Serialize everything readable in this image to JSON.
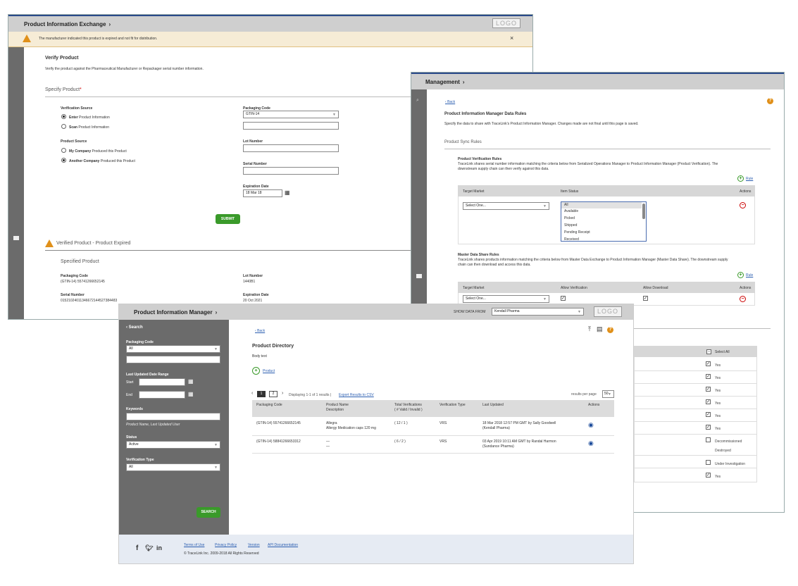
{
  "w1": {
    "title": "Product Information Exchange",
    "logo": "LOGO",
    "alert": "The manufacturer indicated this product is expired and not fit for distribution.",
    "heading": "Verify Product",
    "desc": "Verify the product against the Pharmaceutical Manufacturer or Repackager serial number information.",
    "specify": "Specify Product",
    "req": "*",
    "vsrc_label": "Verification Source",
    "enter_b": "Enter",
    "enter_r": "Product Information",
    "scan_b": "Scan",
    "scan_r": "Product Information",
    "psrc_label": "Product Source",
    "my_b": "My Company",
    "my_r": "Produced this Product",
    "another_b": "Another Company",
    "another_r": "Produced this Product",
    "pkg_label": "Packaging Code",
    "pkg_value": "GTIN-14",
    "lot_label": "Lot Number",
    "serial_label": "Serial Number",
    "exp_label": "Expiration Date",
    "exp_value": "18 Mar 18",
    "submit": "SUBMIT",
    "verified": "Verified Product - Product Expired",
    "specified": "Specified Product",
    "r_pkg_label": "Packaging Code",
    "r_pkg_value": "(GTIN-14) 55741266652145",
    "r_lot_label": "Lot Number",
    "r_lot_value": "1440B1",
    "r_serial_label": "Serial Number",
    "r_serial_value": "01521024011346672144527384483",
    "r_exp_label": "Expiration Date",
    "r_exp_value": "20 Oct 2021"
  },
  "w2": {
    "title": "Management",
    "back": "Back",
    "heading": "Product Information Manager Data Rules",
    "desc": "Specify the data to share with TraceLink's Product Information Manager. Changes made are not final until this page is saved.",
    "sync": "Product Sync Rules",
    "pvr_title": "Product Verification Rules",
    "pvr_desc1": "TraceLink shares serial number information matching the criteria below from Serialized Operations Manager to Product Information Manager (Product Verification). The",
    "pvr_desc2": "downstream supply chain can then verify against this data.",
    "rule": "Rule",
    "col_target": "Target Market",
    "col_status": "Item Status",
    "col_actions": "Actions",
    "select_one": "Select One...",
    "statuses": [
      "All",
      "Available",
      "Picked",
      "Shipped",
      "Pending Receipt",
      "Received"
    ],
    "mds_title": "Master Data Share Rules",
    "mds_desc1": "TraceLink shares products information matching the criteria below from Master Data Exchange to Product Information Manager (Master Data Share). The downstream supply",
    "mds_desc2": "chain can then download and access this data.",
    "col_allow_ver": "Allow Verification",
    "col_allow_dl": "Allow Download",
    "select_all": "Select All",
    "right_items": [
      "Yes",
      "Yes",
      "Yes",
      "Yes",
      "Yes",
      "Yes",
      "Decommissioned",
      "Destroyed",
      "Under Investigation",
      "Yes"
    ]
  },
  "w3": {
    "title": "Product Information Manager",
    "show_from": "SHOW DATA FROM",
    "company": "Kendall Pharma",
    "logo": "LOGO",
    "search": "Search",
    "f_pkg": "Packaging Code",
    "f_pkg_val": "All",
    "f_date": "Last Updated Date Range",
    "f_start": "Start",
    "f_end": "End",
    "f_keywords": "Keywords",
    "f_kw_hint": "Product Name, Last Updated User",
    "f_status": "Status",
    "f_status_val": "Active",
    "f_vtype": "Verification Type",
    "f_vtype_val": "All",
    "search_btn": "SEARCH",
    "back": "Back",
    "heading": "Product Directory",
    "body": "Body text",
    "add_product": "Product",
    "page1": "1",
    "page2": "2",
    "displaying": "Displaying 1-1 of 1 results |",
    "export": "Export Results to CSV",
    "rpp": "results per page",
    "rpp_val": "50",
    "cols": [
      "Packaging Code",
      "Product Name",
      "Description",
      "Total Verifications",
      "( # Valid / Invalid )",
      "Verification Type",
      "Last Updated",
      "Actions"
    ],
    "rows": [
      {
        "pkg": "(GTIN-14) 55741266652145",
        "name": "Allegra",
        "desc": "Allergy Medication caps 120 mg",
        "tv": "( 12 / 1 )",
        "vt": "VRS",
        "lu1": "18 Mar 2018 12:57 PM GMT by Sally Goodwell",
        "lu2": "(Kendall Pharma)"
      },
      {
        "pkg": "(GTIN-14) 58841266653312",
        "name": "—",
        "desc": "—",
        "tv": "( 6 / 2 )",
        "vt": "VRS",
        "lu1": "03 Apr 2019 10:11 AM GMT by Randal Harmon",
        "lu2": "(Sundance Pharma)"
      }
    ],
    "footer_links": [
      "Terms of Use",
      "Privacy Policy",
      "Version",
      "API Documentation"
    ],
    "copyright": "© TraceLink Inc. 2009-2018   All Rights Reserved"
  }
}
